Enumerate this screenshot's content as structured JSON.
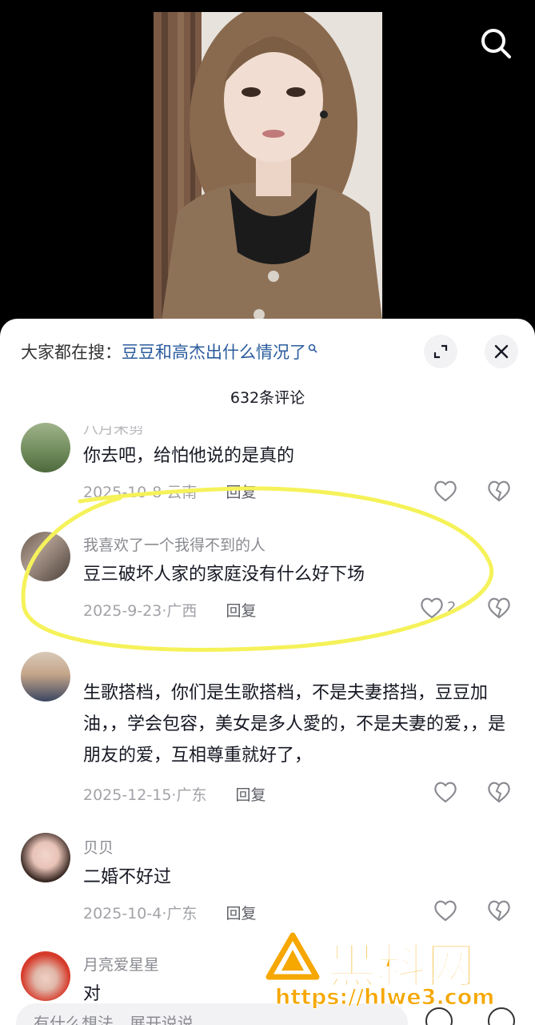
{
  "hot_search": {
    "prefix": "大家都在搜：",
    "query": "豆豆和高杰出什么情况了"
  },
  "comment_count": "632条评论",
  "comments": [
    {
      "user": "八月未剪",
      "text": "你去吧，给怕他说的是真的",
      "date": "2025-10-8",
      "location": "云南",
      "reply": "回复",
      "likes": ""
    },
    {
      "user": "我喜欢了一个我得不到的人",
      "text": "豆三破坏人家的家庭没有什么好下场",
      "date": "2025-9-23",
      "location": "广西",
      "reply": "回复",
      "likes": "2"
    },
    {
      "user": "",
      "text": "生歌搭档，你们是生歌搭档，不是夫妻搭挡，豆豆加油，，学会包容，美女是多人愛的，不是夫妻的爱，，是朋友的爱，互相尊重就好了，",
      "date": "2025-12-15",
      "location": "广东",
      "reply": "回复",
      "likes": ""
    },
    {
      "user": "贝贝",
      "text": "二婚不好过",
      "date": "2025-10-4",
      "location": "广东",
      "reply": "回复",
      "likes": ""
    },
    {
      "user": "月亮爱星星",
      "text": "对",
      "date": "",
      "location": "",
      "reply": "",
      "likes": ""
    }
  ],
  "input": {
    "placeholder": "有什么想法，展开说说"
  },
  "watermark": {
    "brand": "黑料网",
    "url": "https://hlwe3.com"
  },
  "colors": {
    "sheet_bg": "#ffffff",
    "link": "#2b5c9e",
    "highlight": "#f5f25a",
    "watermark": "#f6a700"
  },
  "icons": [
    "search-icon",
    "expand-icon",
    "close-icon",
    "heart-icon",
    "broken-heart-icon",
    "emoji-icon",
    "at-icon"
  ]
}
